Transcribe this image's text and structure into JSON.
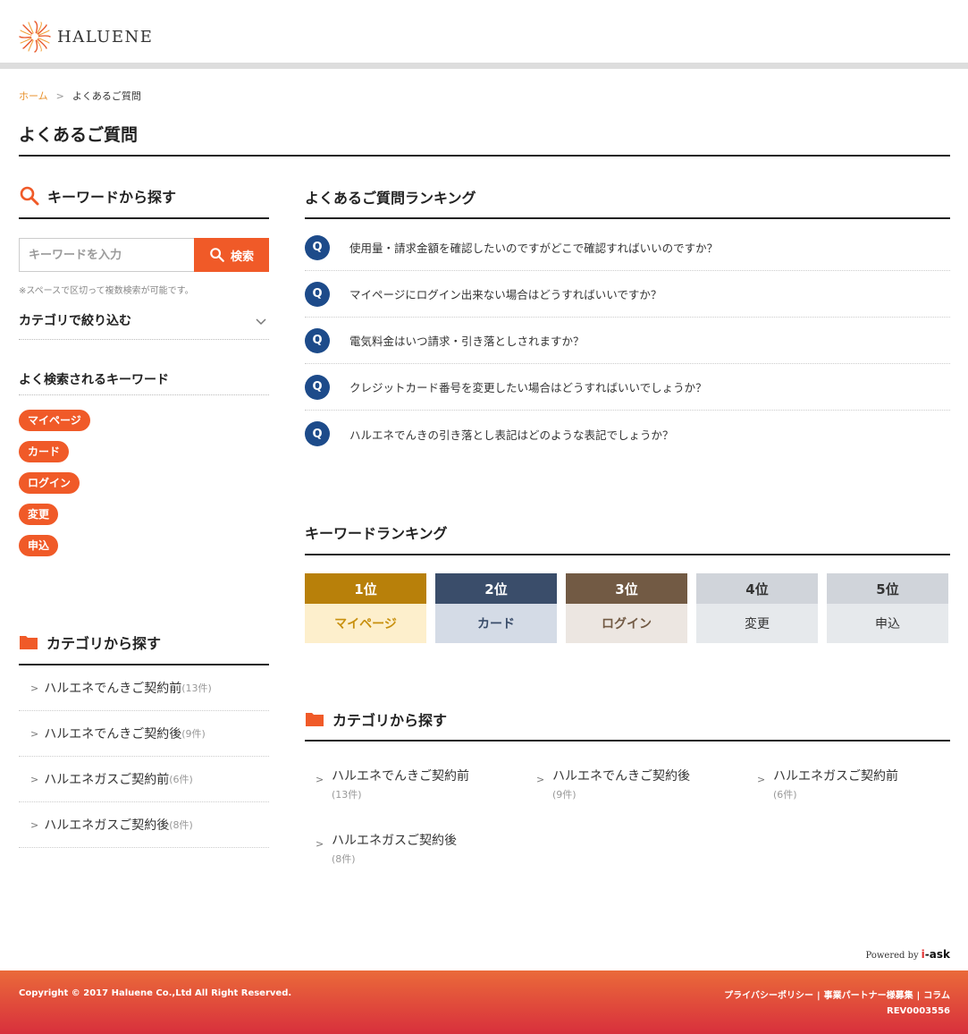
{
  "header": {
    "logo_text": "HALUENE"
  },
  "breadcrumb": {
    "home": "ホーム",
    "separator": ">",
    "current": "よくあるご質問"
  },
  "page_title": "よくあるご質問",
  "keyword_search": {
    "heading": "キーワードから探す",
    "placeholder": "キーワードを入力",
    "button_label": "検索",
    "note": "※スペースで区切って複数検索が可能です。"
  },
  "filter": {
    "label": "カテゴリで絞り込む"
  },
  "popular_keywords": {
    "heading": "よく検索されるキーワード",
    "tags": [
      "マイページ",
      "カード",
      "ログイン",
      "変更",
      "申込"
    ]
  },
  "category_left": {
    "heading": "カテゴリから探す",
    "items": [
      {
        "label": "ハルエネでんきご契約前",
        "count": "(13件)"
      },
      {
        "label": "ハルエネでんきご契約後",
        "count": "(9件)"
      },
      {
        "label": "ハルエネガスご契約前",
        "count": "(6件)"
      },
      {
        "label": "ハルエネガスご契約後",
        "count": "(8件)"
      }
    ]
  },
  "faq_ranking": {
    "heading": "よくあるご質問ランキング",
    "badge": "Q",
    "items": [
      "使用量・請求金額を確認したいのですがどこで確認すればいいのですか？",
      "マイページにログイン出来ない場合はどうすればいいですか？",
      "電気料金はいつ請求・引き落としされますか？",
      "クレジットカード番号を変更したい場合はどうすればいいでしょうか？",
      "ハルエネでんきの引き落とし表記はどのような表記でしょうか？"
    ]
  },
  "keyword_ranking": {
    "heading": "キーワードランキング",
    "items": [
      {
        "rank": "1位",
        "keyword": "マイページ",
        "top_color": "#b8800a",
        "bottom_color": "#fdefcc",
        "text_color": "#c8900f"
      },
      {
        "rank": "2位",
        "keyword": "カード",
        "top_color": "#3a4d6a",
        "bottom_color": "#d4dbe6",
        "text_color": "#3a4d6a"
      },
      {
        "rank": "3位",
        "keyword": "ログイン",
        "top_color": "#725a44",
        "bottom_color": "#ece6e1",
        "text_color": "#725a44"
      },
      {
        "rank": "4位",
        "keyword": "変更",
        "top_color": "#d0d4da",
        "bottom_color": "#e6e9ec",
        "text_color": "#333333"
      },
      {
        "rank": "5位",
        "keyword": "申込",
        "top_color": "#d0d4da",
        "bottom_color": "#e6e9ec",
        "text_color": "#333333"
      }
    ]
  },
  "category_right": {
    "heading": "カテゴリから探す",
    "items": [
      {
        "label": "ハルエネでんきご契約前",
        "count": "(13件)"
      },
      {
        "label": "ハルエネでんきご契約後",
        "count": "(9件)"
      },
      {
        "label": "ハルエネガスご契約前",
        "count": "(6件)"
      },
      {
        "label": "ハルエネガスご契約後",
        "count": "(8件)"
      }
    ]
  },
  "powered_by": {
    "prefix": "Powered by",
    "brand_i": "i",
    "brand_rest": "-ask"
  },
  "footer": {
    "copyright": "Copyright © 2017 Haluene Co.,Ltd All Right Reserved.",
    "links": [
      "プライバシーポリシー",
      "事業パートナー様募集",
      "コラム"
    ],
    "revision": "REV0003556"
  },
  "colors": {
    "accent": "#f05a28",
    "faq_badge": "#1d4b8a",
    "breadcrumb_link": "#e8912c"
  }
}
